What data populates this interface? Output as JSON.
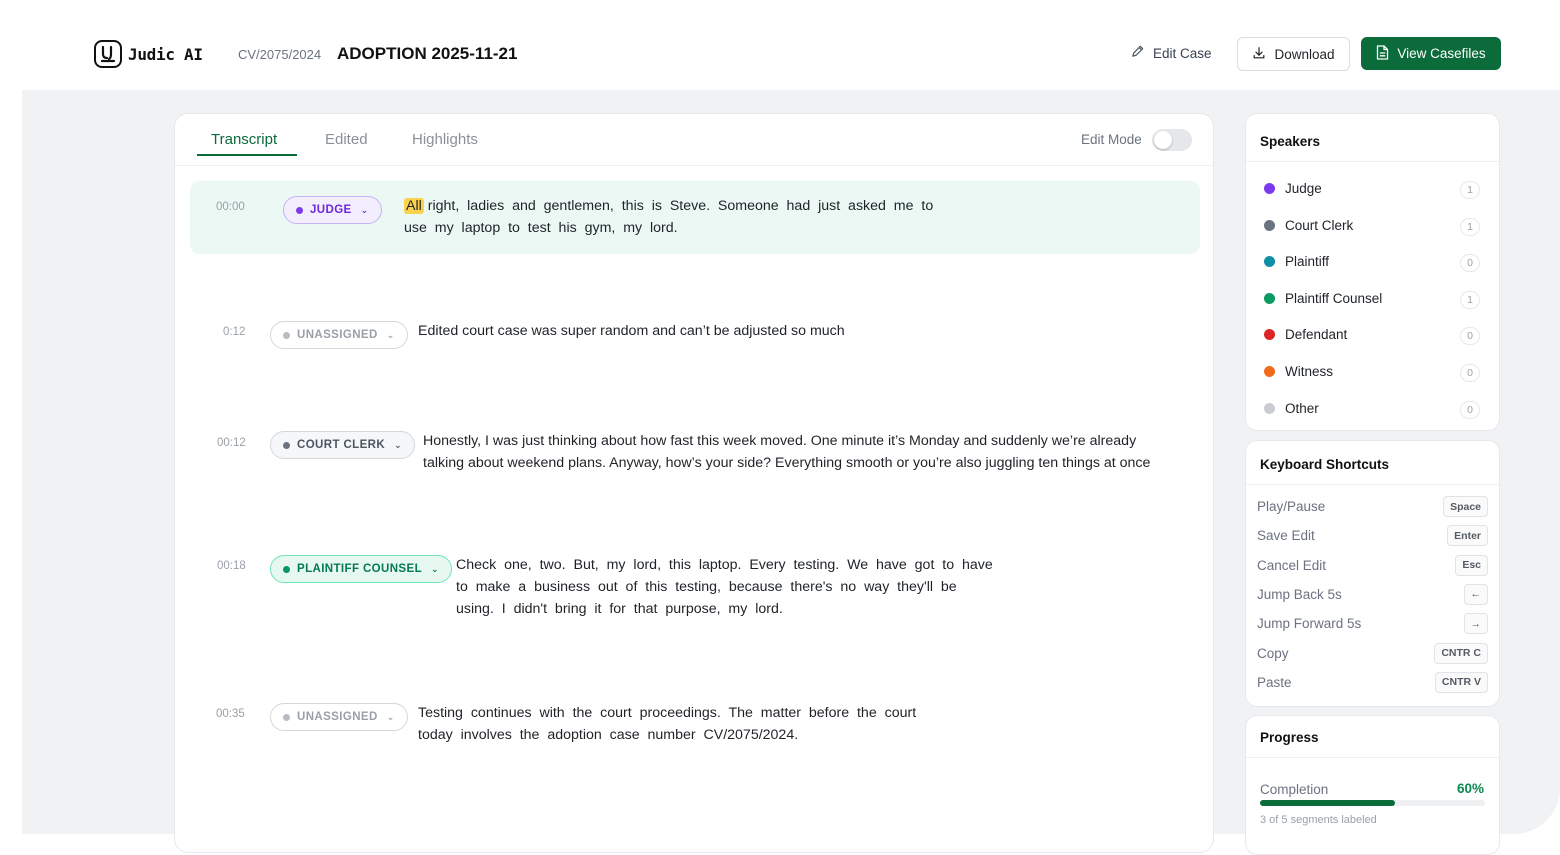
{
  "app": {
    "name": "Judic AI"
  },
  "case": {
    "id": "CV/2075/2024",
    "title": "ADOPTION 2025-11-21"
  },
  "header": {
    "edit_case_label": "Edit Case",
    "download_label": "Download",
    "view_casefiles_label": "View Casefiles"
  },
  "tabs": [
    {
      "label": "Transcript",
      "active": true
    },
    {
      "label": "Edited",
      "active": false
    },
    {
      "label": "Highlights",
      "active": false
    }
  ],
  "edit_mode": {
    "label": "Edit Mode",
    "enabled": false
  },
  "segments": [
    {
      "time": "00:00",
      "speaker": "JUDGE",
      "highlight_word": "All",
      "lines": [
        " right,  ladies  and  gentlemen,  this  is  Steve.  Someone  had  just  asked  me  to",
        "use  my  laptop  to  test  his  gym,  my  lord."
      ]
    },
    {
      "time": "0:12",
      "speaker": "UNASSIGNED",
      "lines": [
        "Edited court case was super random and can’t be adjusted so much"
      ]
    },
    {
      "time": "00:12",
      "speaker": "COURT CLERK",
      "lines": [
        "Honestly, I was just thinking about how fast this week moved. One minute it’s Monday and suddenly we’re already",
        "talking about weekend plans. Anyway, how’s your side? Everything smooth or you’re also juggling ten things at once"
      ]
    },
    {
      "time": "00:18",
      "speaker": "PLAINTIFF COUNSEL",
      "lines": [
        "Check  one,  two.  But,  my  lord,  this  laptop.  Every  testing.  We  have  got  to  have",
        "to  make  a  business  out  of  this  testing,  because  there's  no  way  they'll  be",
        "using.  I  didn't  bring  it  for  that  purpose,  my  lord."
      ]
    },
    {
      "time": "00:35",
      "speaker": "UNASSIGNED",
      "lines": [
        "Testing  continues  with  the  court  proceedings.  The  matter  before  the  court",
        "today  involves  the  adoption  case  number  CV/2075/2024."
      ]
    }
  ],
  "speakers_panel": {
    "title": "Speakers",
    "items": [
      {
        "name": "Judge",
        "count": "1",
        "color": "#7c3aed"
      },
      {
        "name": "Court Clerk",
        "count": "1",
        "color": "#6b7280"
      },
      {
        "name": "Plaintiff",
        "count": "0",
        "color": "#0e8fa5"
      },
      {
        "name": "Plaintiff Counsel",
        "count": "1",
        "color": "#0b9a62"
      },
      {
        "name": "Defendant",
        "count": "0",
        "color": "#dc2626"
      },
      {
        "name": "Witness",
        "count": "0",
        "color": "#f06a1c"
      },
      {
        "name": "Other",
        "count": "0",
        "color": "#c9ccd1"
      }
    ]
  },
  "shortcuts_panel": {
    "title": "Keyboard Shortcuts",
    "items": [
      {
        "label": "Play/Pause",
        "key": "Space"
      },
      {
        "label": "Save Edit",
        "key": "Enter"
      },
      {
        "label": "Cancel Edit",
        "key": "Esc"
      },
      {
        "label": "Jump Back 5s",
        "key": "←"
      },
      {
        "label": "Jump Forward 5s",
        "key": "→"
      },
      {
        "label": "Copy",
        "key": "CNTR C"
      },
      {
        "label": "Paste",
        "key": "CNTR V"
      }
    ]
  },
  "progress_panel": {
    "title": "Progress",
    "completion_label": "Completion",
    "percent_text": "60%",
    "fraction": 0.6,
    "subtext": "3 of 5 segments labeled"
  }
}
